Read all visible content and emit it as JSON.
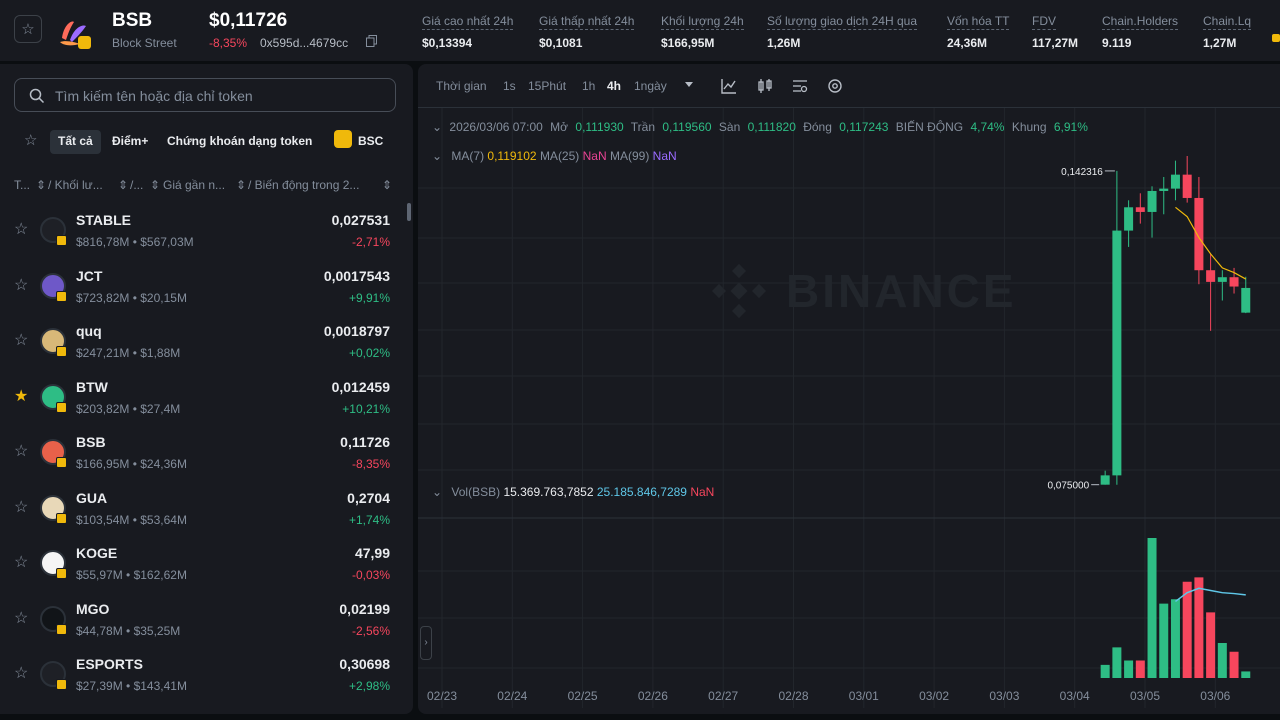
{
  "header": {
    "symbol": "BSB",
    "full_name": "Block Street",
    "price": "$0,11726",
    "change": "-8,35%",
    "address": "0x595d...4679cc",
    "stats": [
      {
        "label": "Giá cao nhất 24h",
        "value": "$0,13394"
      },
      {
        "label": "Giá thấp nhất 24h",
        "value": "$0,1081"
      },
      {
        "label": "Khối lượng 24h",
        "value": "$166,95M"
      },
      {
        "label": "Số lượng giao dịch 24H qua",
        "value": "1,26M"
      },
      {
        "label": "Vốn hóa TT",
        "value": "24,36M"
      },
      {
        "label": "FDV",
        "value": "117,27M"
      },
      {
        "label": "Chain.Holders",
        "value": "9.119"
      },
      {
        "label": "Chain.Lq",
        "value": "1,27M"
      }
    ]
  },
  "sidebar": {
    "search_placeholder": "Tìm kiếm tên hoặc địa chỉ token",
    "filters": [
      "Tất cả",
      "Điểm+",
      "Chứng khoán dạng token",
      "BSC"
    ],
    "columns": [
      "T...",
      "/ Khối lư...",
      "/...",
      "Giá gần n...",
      "/ Biến động trong 2..."
    ],
    "tokens": [
      {
        "name": "STABLE",
        "sub": "$816,78M • $567,03M",
        "price": "0,027531",
        "change": "-2,71%",
        "dir": "down",
        "starred": false,
        "color": "#1e2026"
      },
      {
        "name": "JCT",
        "sub": "$723,82M • $20,15M",
        "price": "0,0017543",
        "change": "+9,91%",
        "dir": "up",
        "starred": false,
        "color": "#6e58c8"
      },
      {
        "name": "quq",
        "sub": "$247,21M • $1,88M",
        "price": "0,0018797",
        "change": "+0,02%",
        "dir": "up",
        "starred": false,
        "color": "#d8b878"
      },
      {
        "name": "BTW",
        "sub": "$203,82M • $27,4M",
        "price": "0,012459",
        "change": "+10,21%",
        "dir": "up",
        "starred": true,
        "color": "#2ebd85"
      },
      {
        "name": "BSB",
        "sub": "$166,95M • $24,36M",
        "price": "0,11726",
        "change": "-8,35%",
        "dir": "down",
        "starred": false,
        "color": "#e8614a"
      },
      {
        "name": "GUA",
        "sub": "$103,54M • $53,64M",
        "price": "0,2704",
        "change": "+1,74%",
        "dir": "up",
        "starred": false,
        "color": "#e8d8b8"
      },
      {
        "name": "KOGE",
        "sub": "$55,97M • $162,62M",
        "price": "47,99",
        "change": "-0,03%",
        "dir": "down",
        "starred": false,
        "color": "#f5f5f5"
      },
      {
        "name": "MGO",
        "sub": "$44,78M • $35,25M",
        "price": "0,02199",
        "change": "-2,56%",
        "dir": "down",
        "starred": false,
        "color": "#111418"
      },
      {
        "name": "ESPORTS",
        "sub": "$27,39M • $143,41M",
        "price": "0,30698",
        "change": "+2,98%",
        "dir": "up",
        "starred": false,
        "color": "#1e2026"
      }
    ]
  },
  "chart": {
    "toolbar": {
      "time_label": "Thời gian",
      "intervals": [
        "1s",
        "15Phút",
        "1h",
        "4h",
        "1ngày"
      ],
      "active": "4h"
    },
    "ohlc": {
      "date": "2026/03/06 07:00",
      "open_label": "Mở",
      "open": "0,111930",
      "high_label": "Trần",
      "high": "0,119560",
      "low_label": "Sàn",
      "low": "0,111820",
      "close_label": "Đóng",
      "close": "0,117243",
      "change_label": "BIẾN ĐỘNG",
      "change": "4,74%",
      "range_label": "Khung",
      "range": "6,91%"
    },
    "ma": {
      "ma7_label": "MA(7)",
      "ma7": "0,119102",
      "ma25_label": "MA(25)",
      "ma25": "NaN",
      "ma99_label": "MA(99)",
      "ma99": "NaN"
    },
    "vol": {
      "label": "Vol(BSB)",
      "v1": "15.369.763,7852",
      "v2": "25.185.846,7289",
      "v3": "NaN"
    },
    "high_marker": "0,142316",
    "low_marker": "0,075000",
    "watermark": "BINANCE",
    "colors": {
      "up": "#2ebd85",
      "down": "#f6465d",
      "ma7": "#f0b90b",
      "vol_ma": "#5fc7e8"
    }
  },
  "chart_data": {
    "type": "candlestick",
    "x_ticks": [
      "02/23",
      "02/24",
      "02/25",
      "02/26",
      "02/27",
      "02/28",
      "03/01",
      "03/02",
      "03/03",
      "03/04",
      "03/05",
      "03/06"
    ],
    "candles": [
      {
        "o": 0.075,
        "h": 0.078,
        "l": 0.075,
        "c": 0.077
      },
      {
        "o": 0.077,
        "h": 0.1423,
        "l": 0.075,
        "c": 0.1295
      },
      {
        "o": 0.1295,
        "h": 0.136,
        "l": 0.126,
        "c": 0.1345
      },
      {
        "o": 0.1345,
        "h": 0.1375,
        "l": 0.131,
        "c": 0.1335
      },
      {
        "o": 0.1335,
        "h": 0.139,
        "l": 0.128,
        "c": 0.138
      },
      {
        "o": 0.138,
        "h": 0.141,
        "l": 0.133,
        "c": 0.1385
      },
      {
        "o": 0.1385,
        "h": 0.1445,
        "l": 0.136,
        "c": 0.1415
      },
      {
        "o": 0.1415,
        "h": 0.1455,
        "l": 0.1355,
        "c": 0.1365
      },
      {
        "o": 0.1365,
        "h": 0.141,
        "l": 0.118,
        "c": 0.121
      },
      {
        "o": 0.121,
        "h": 0.1245,
        "l": 0.108,
        "c": 0.1185
      },
      {
        "o": 0.1185,
        "h": 0.121,
        "l": 0.1145,
        "c": 0.1195
      },
      {
        "o": 0.1195,
        "h": 0.1215,
        "l": 0.116,
        "c": 0.1175
      },
      {
        "o": 0.1119,
        "h": 0.1196,
        "l": 0.1118,
        "c": 0.1172
      }
    ],
    "volume": [
      3,
      7,
      4,
      4,
      32,
      17,
      18,
      22,
      23,
      15,
      8,
      6,
      1.5
    ],
    "ma7": [
      null,
      null,
      null,
      null,
      null,
      null,
      0.1345,
      0.1325,
      0.128,
      0.1245,
      0.1215,
      0.1205,
      0.1191
    ],
    "vol_ma": [
      null,
      null,
      null,
      null,
      null,
      null,
      17.5,
      19.5,
      20.5,
      20,
      19.5,
      19.3,
      19
    ]
  }
}
